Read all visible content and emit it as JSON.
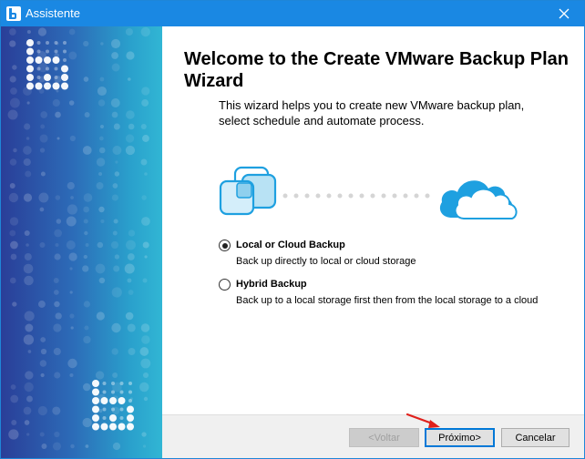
{
  "window": {
    "title": "Assistente",
    "icons": {
      "app": "backup-app-icon",
      "close": "close-icon"
    },
    "accent": "#1a88e3"
  },
  "main": {
    "heading": "Welcome to the Create VMware Backup Plan Wizard",
    "description": "This wizard helps you to create new VMware backup plan, select schedule and automate process.",
    "illustration": {
      "left_icon": "vmware-stack-icon",
      "right_icon": "cloud-icon",
      "color": "#1ea0e0"
    },
    "options": [
      {
        "label": "Local or Cloud Backup",
        "description": "Back up directly to local or cloud storage",
        "selected": true
      },
      {
        "label": "Hybrid Backup",
        "description": "Back up to a local storage first then from the local storage to a cloud",
        "selected": false
      }
    ]
  },
  "footer": {
    "back_label": "<Voltar",
    "next_label": "Próximo>",
    "cancel_label": "Cancelar"
  }
}
